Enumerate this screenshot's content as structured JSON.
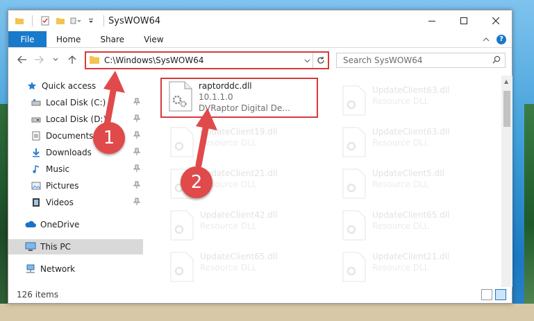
{
  "window": {
    "title": "SysWOW64"
  },
  "ribbon": {
    "tabs": [
      "File",
      "Home",
      "Share",
      "View"
    ]
  },
  "address": {
    "path": "C:\\Windows\\SysWOW64"
  },
  "search": {
    "placeholder": "Search SysWOW64"
  },
  "sidebar": {
    "items": [
      {
        "label": "Quick access",
        "icon": "star-icon",
        "pinned": false
      },
      {
        "label": "Local Disk (C:)",
        "icon": "drive-icon",
        "pinned": true
      },
      {
        "label": "Local Disk (D:)",
        "icon": "drive-icon",
        "pinned": true
      },
      {
        "label": "Documents",
        "icon": "documents-icon",
        "pinned": true
      },
      {
        "label": "Downloads",
        "icon": "downloads-icon",
        "pinned": true
      },
      {
        "label": "Music",
        "icon": "music-icon",
        "pinned": true
      },
      {
        "label": "Pictures",
        "icon": "pictures-icon",
        "pinned": true
      },
      {
        "label": "Videos",
        "icon": "videos-icon",
        "pinned": true
      },
      {
        "label": "OneDrive",
        "icon": "onedrive-icon",
        "pinned": false
      },
      {
        "label": "This PC",
        "icon": "computer-icon",
        "pinned": false,
        "selected": true
      },
      {
        "label": "Network",
        "icon": "network-icon",
        "pinned": false
      }
    ]
  },
  "files": [
    {
      "name": "raptorddc.dll",
      "line2": "10.1.1.0",
      "line3": "DVRaptor Digital De...",
      "highlighted": true
    },
    {
      "name": "UpdateClient63.dll",
      "line2": "Resource DLL"
    },
    {
      "name": "UpdateClient19.dll",
      "line2": "Resource DLL"
    },
    {
      "name": "UpdateClient63.dll",
      "line2": "Resource DLL"
    },
    {
      "name": "UpdateClient21.dll",
      "line2": "Resource DLL"
    },
    {
      "name": "UpdateClient5.dll",
      "line2": "Resource DLL"
    },
    {
      "name": "UpdateClient42.dll",
      "line2": "Resource DLL"
    },
    {
      "name": "UpdateClient65.dll",
      "line2": "Resource DLL"
    },
    {
      "name": "UpdateClient65.dll",
      "line2": "Resource DLL"
    },
    {
      "name": "UpdateClient21.dll",
      "line2": "Resource DLL"
    }
  ],
  "status": {
    "items": "126 items"
  },
  "annotations": {
    "step1": "1",
    "step2": "2",
    "color": "#e04a4b"
  }
}
